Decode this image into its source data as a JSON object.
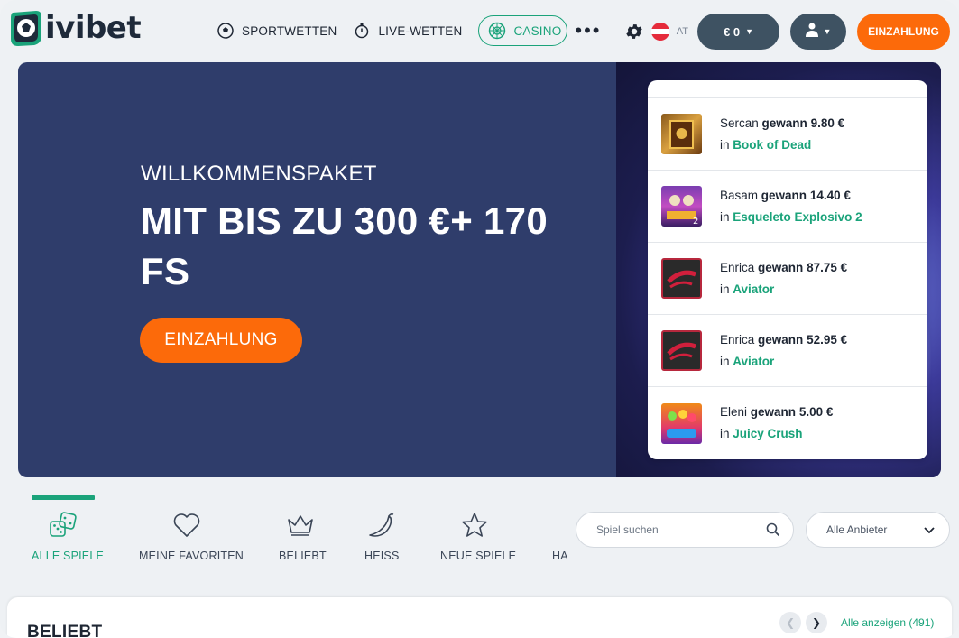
{
  "brand": {
    "name": "ivibet"
  },
  "nav": {
    "items": [
      {
        "label": "SPORTWETTEN",
        "icon": "soccer-ball-icon"
      },
      {
        "label": "LIVE-WETTEN",
        "icon": "stopwatch-icon"
      },
      {
        "label": "CASINO",
        "icon": "roulette-icon",
        "active": true
      }
    ],
    "more": "•••"
  },
  "header": {
    "country": "AT",
    "balance": "€ 0",
    "deposit_label": "EINZAHLUNG"
  },
  "hero": {
    "subtitle": "WILLKOMMENSPAKET",
    "title": "MIT BIS ZU 300 €+ 170 FS",
    "cta": "EINZAHLUNG"
  },
  "winners": [
    {
      "name": "Sercan",
      "verb": "gewann",
      "amount": "9.80 €",
      "in": "in",
      "game": "Book of Dead",
      "thumb": "book-of-dead"
    },
    {
      "name": "Basam",
      "verb": "gewann",
      "amount": "14.40 €",
      "in": "in",
      "game": "Esqueleto Explosivo 2",
      "thumb": "esqueleto"
    },
    {
      "name": "Enrica",
      "verb": "gewann",
      "amount": "87.75 €",
      "in": "in",
      "game": "Aviator",
      "thumb": "aviator"
    },
    {
      "name": "Enrica",
      "verb": "gewann",
      "amount": "52.95 €",
      "in": "in",
      "game": "Aviator",
      "thumb": "aviator"
    },
    {
      "name": "Eleni",
      "verb": "gewann",
      "amount": "5.00 €",
      "in": "in",
      "game": "Juicy Crush",
      "thumb": "juicy-crush"
    }
  ],
  "categories": [
    {
      "label": "ALLE SPIELE",
      "icon": "dice-icon",
      "active": true
    },
    {
      "label": "MEINE FAVORITEN",
      "icon": "heart-icon"
    },
    {
      "label": "BELIEBT",
      "icon": "crown-icon"
    },
    {
      "label": "HEISS",
      "icon": "chili-icon"
    },
    {
      "label": "NEUE SPIELE",
      "icon": "star-icon"
    },
    {
      "label": "HA",
      "icon": ""
    }
  ],
  "search": {
    "placeholder": "Spiel suchen"
  },
  "provider": {
    "selected": "Alle Anbieter"
  },
  "section": {
    "title": "BELIEBT",
    "show_all": "Alle anzeigen (491)"
  },
  "colors": {
    "accent": "#1aa37a",
    "cta": "#fc6a0a",
    "hero_bg": "#2f3d6b",
    "dark_button": "#3e5262"
  }
}
